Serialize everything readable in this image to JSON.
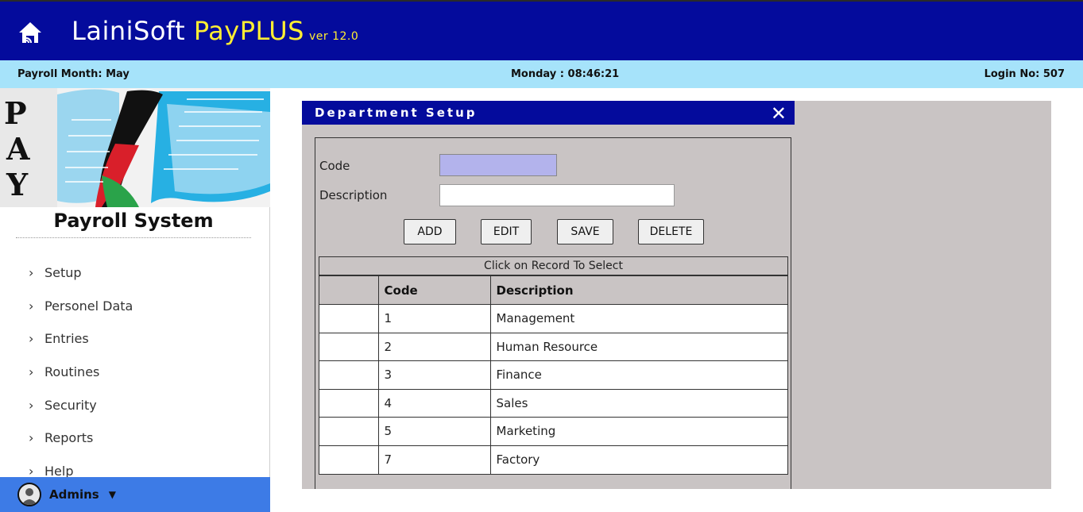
{
  "header": {
    "brand_main": "LainiSoft",
    "brand_accent": "PayPLUS",
    "version": "ver 12.0",
    "home_icon": "home-icon"
  },
  "infobar": {
    "payroll_month": "Payroll Month: May",
    "clock": "Monday : 08:46:21",
    "login": "Login No: 507"
  },
  "sidebar": {
    "logo_letters": [
      "P",
      "A",
      "Y"
    ],
    "title": "Payroll System",
    "items": [
      {
        "label": "Setup"
      },
      {
        "label": "Personel Data"
      },
      {
        "label": "Entries"
      },
      {
        "label": "Routines"
      },
      {
        "label": "Security"
      },
      {
        "label": "Reports"
      },
      {
        "label": "Help"
      }
    ],
    "user": "Admins"
  },
  "dialog": {
    "title": "Department Setup",
    "close": "✕",
    "code_label": "Code",
    "code_value": "",
    "description_label": "Description",
    "description_value": "",
    "buttons": {
      "add": "ADD",
      "edit": "EDIT",
      "save": "SAVE",
      "delete": "DELETE"
    },
    "grid_caption": "Click on Record To Select",
    "columns": {
      "code": "Code",
      "description": "Description"
    },
    "rows": [
      {
        "code": "1",
        "description": "Management"
      },
      {
        "code": "2",
        "description": "Human Resource"
      },
      {
        "code": "3",
        "description": "Finance"
      },
      {
        "code": "4",
        "description": "Sales"
      },
      {
        "code": "5",
        "description": "Marketing"
      },
      {
        "code": "7",
        "description": "Factory"
      }
    ]
  },
  "colors": {
    "header_bg": "#040b9c",
    "infobar_bg": "#a6e3fa",
    "accent_yellow": "#ffee33",
    "user_bar_bg": "#3d7be6",
    "panel_gray": "#c9c4c4",
    "code_input_bg": "#b3b3ec"
  }
}
